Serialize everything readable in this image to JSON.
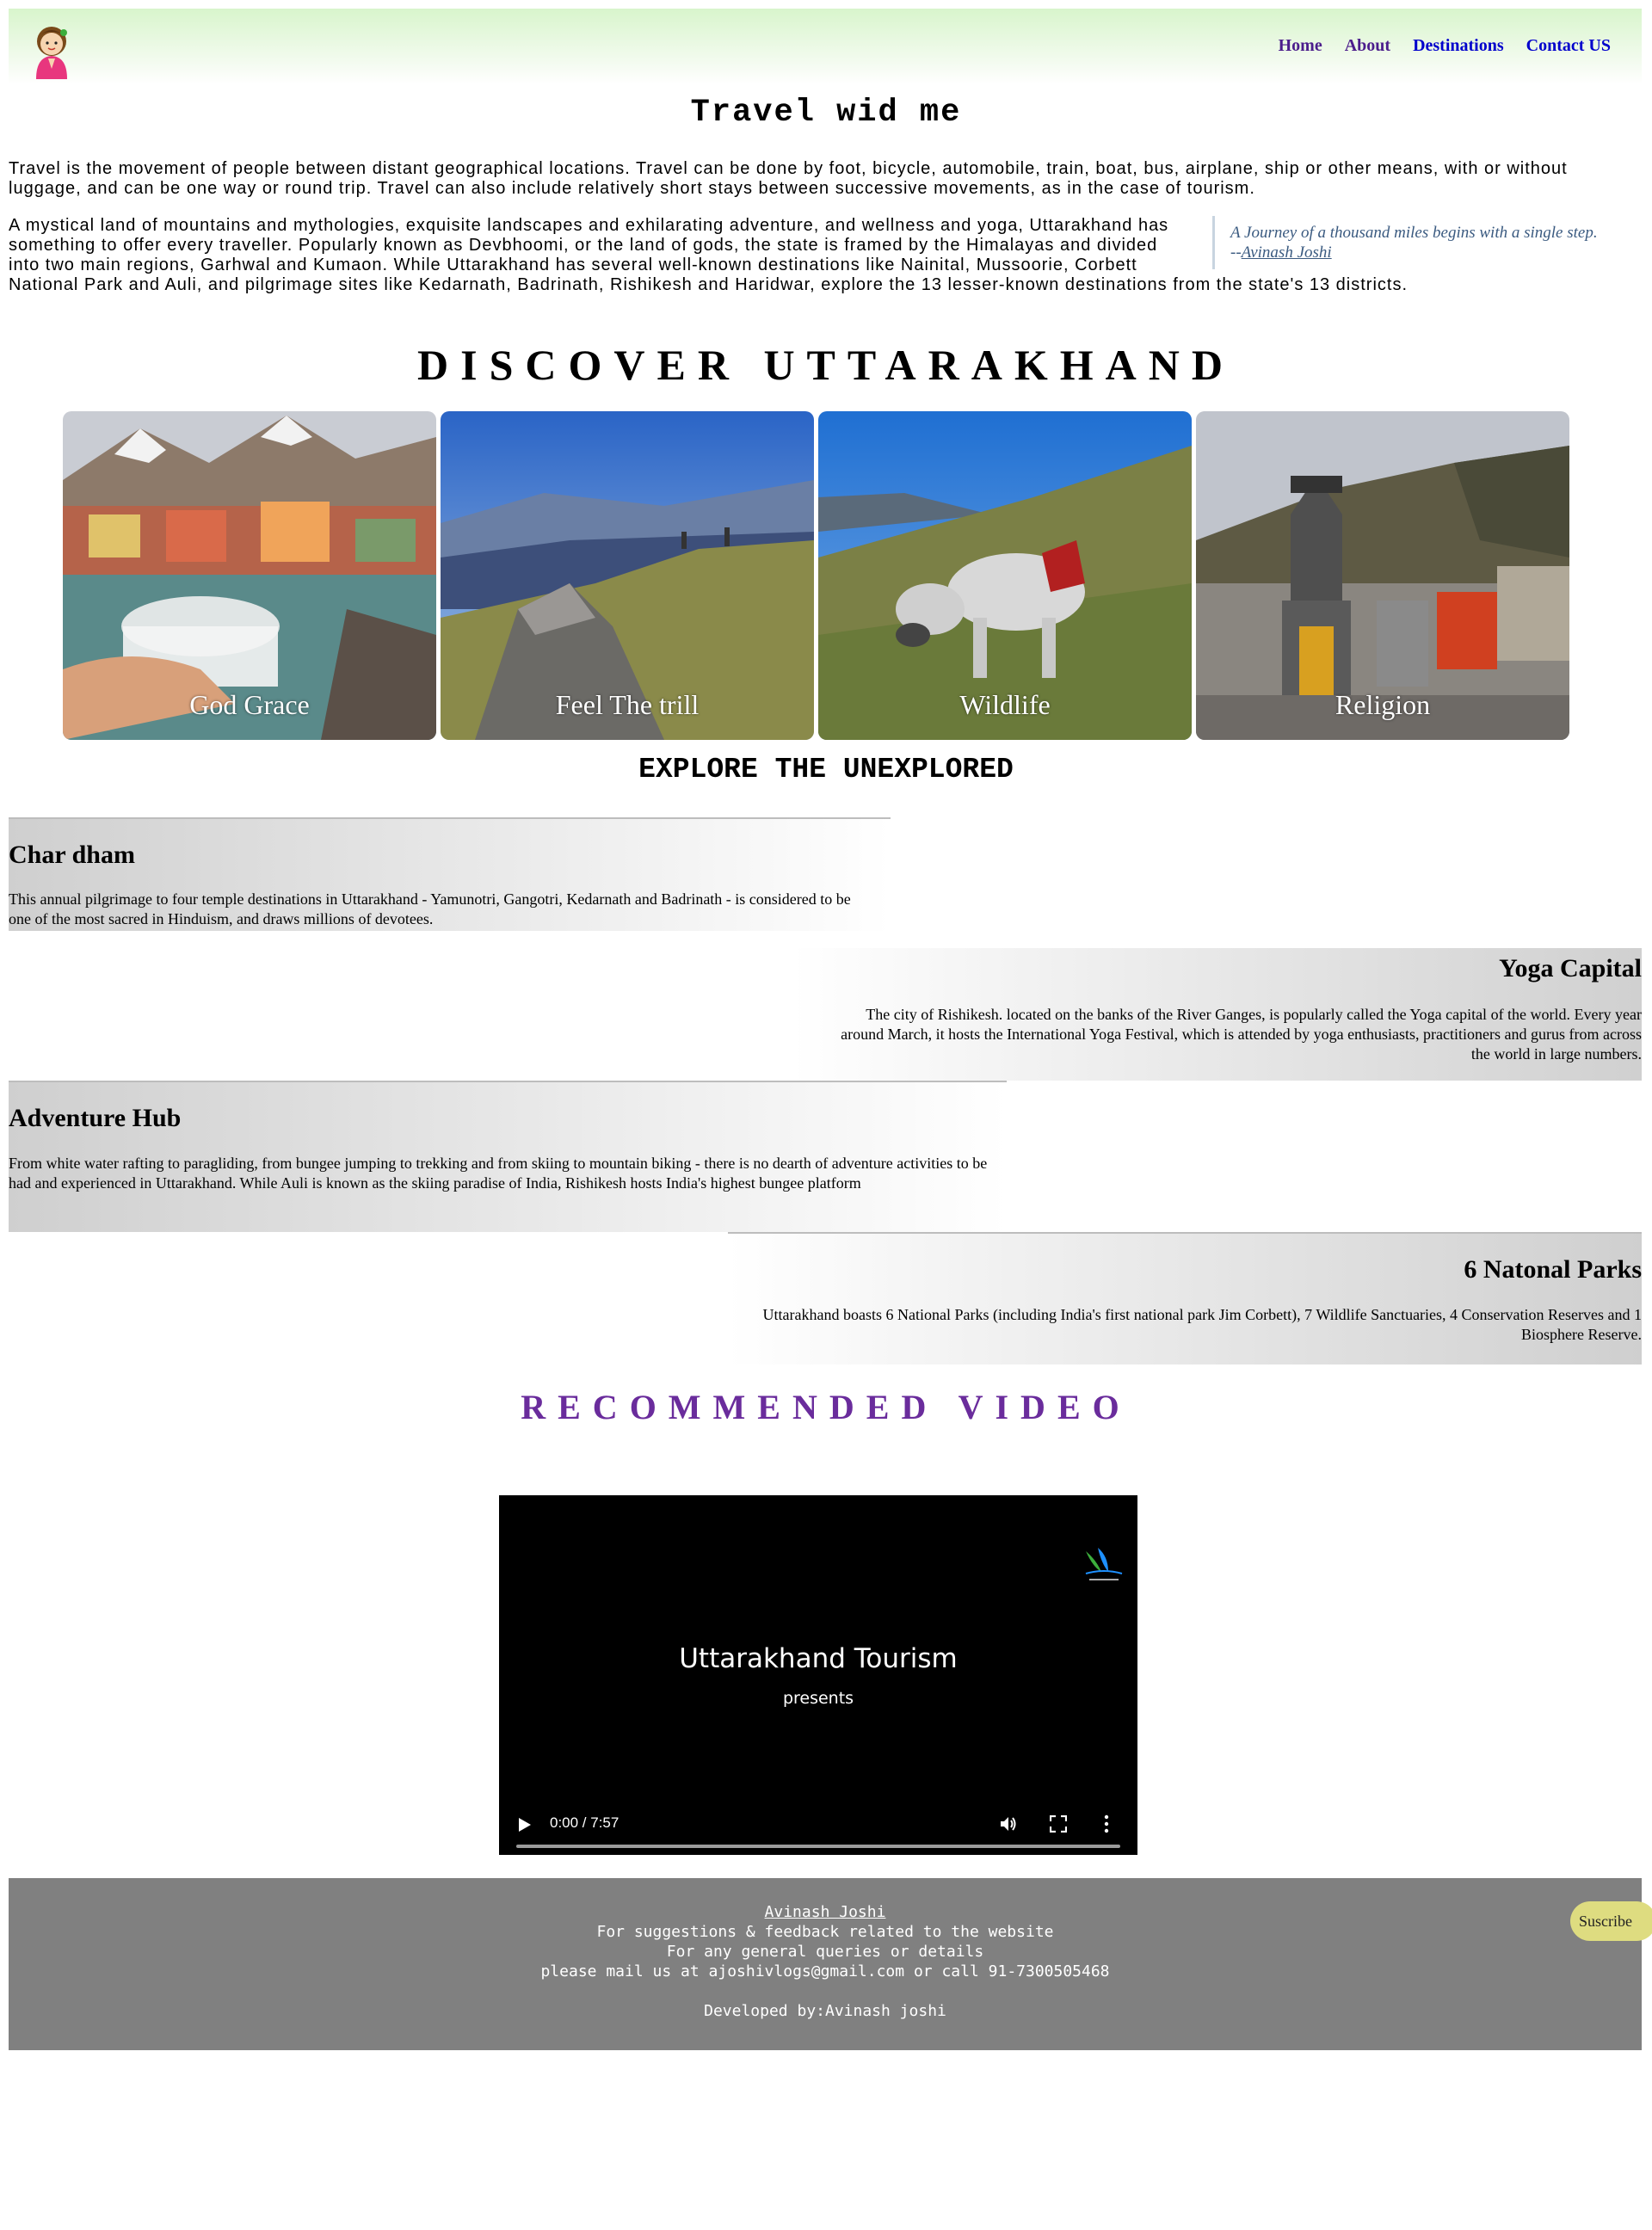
{
  "header": {
    "logo_icon": "girl-namaste-icon",
    "nav": [
      {
        "label": "Home",
        "state": "visited"
      },
      {
        "label": "About",
        "state": "visited"
      },
      {
        "label": "Destinations",
        "state": "link"
      },
      {
        "label": "Contact US",
        "state": "link"
      }
    ]
  },
  "intro": {
    "title": "Travel wid me",
    "paragraph1": "Travel is the movement of people between distant geographical locations. Travel can be done by foot, bicycle, automobile, train, boat, bus, airplane, ship or other means, with or without luggage, and can be one way or round trip. Travel can also include relatively short stays between successive movements, as in the case of tourism.",
    "paragraph2": "A mystical land of mountains and mythologies, exquisite landscapes and exhilarating adventure, and wellness and yoga, Uttarakhand has something to offer every traveller. Popularly known as Devbhoomi, or the land of gods, the state is framed by the Himalayas and divided into two main regions, Garhwal and Kumaon. While Uttarakhand has several well-known destinations like Nainital, Mussoorie, Corbett National Park and Auli, and pilgrimage sites like Kedarnath, Badrinath, Rishikesh and Haridwar, explore the 13 lesser-known destinations from the state's 13 districts.",
    "quote": "A Journey of a thousand miles begins with a single step.",
    "quote_prefix": "--",
    "quote_author": "Avinash Joshi"
  },
  "discover": {
    "heading": "DISCOVER UTTARAKHAND",
    "cards": [
      {
        "caption": "God Grace"
      },
      {
        "caption": "Feel The trill"
      },
      {
        "caption": "Wildlife"
      },
      {
        "caption": "Religion"
      }
    ]
  },
  "explore": {
    "heading": "EXPLORE THE UNEXPLORED",
    "sections": [
      {
        "title": "Char dham",
        "text": "This annual pilgrimage to four temple destinations in Uttarakhand - Yamunotri, Gangotri, Kedarnath and Badrinath - is considered to be one of the most sacred in Hinduism, and draws millions of devotees."
      },
      {
        "title": "Yoga Capital",
        "text": "The city of Rishikesh. located on the banks of the River Ganges, is popularly called the Yoga capital of the world. Every year around March, it hosts the International Yoga Festival, which is attended by yoga enthusiasts, practitioners and gurus from across the world in large numbers."
      },
      {
        "title": "Adventure Hub",
        "text": "From white water rafting to paragliding, from bungee jumping to trekking and from skiing to mountain biking - there is no dearth of adventure activities to be had and experienced in Uttarakhand. While Auli is known as the skiing paradise of India, Rishikesh hosts India's highest bungee platform"
      },
      {
        "title": "6 Natonal Parks",
        "text": "Uttarakhand boasts 6 National Parks (including India's first national park Jim Corbett), 7 Wildlife Sanctuaries, 4 Conservation Reserves and 1 Biosphere Reserve."
      }
    ]
  },
  "video": {
    "heading": "RECOMMENDED VIDEO",
    "title": "Uttarakhand Tourism",
    "subtitle": "presents",
    "time": "0:00 / 7:57",
    "progress": 0
  },
  "footer": {
    "name": "Avinash Joshi",
    "line1": "For suggestions & feedback related to the website",
    "line2": "For any general queries or details",
    "line3": "please mail us at ajoshivlogs@gmail.com or call 91-7300505468",
    "credit": "Developed by:Avinash joshi",
    "subscribe": "Suscribe"
  },
  "colors": {
    "nav_visited": "#4b1d8c",
    "nav_link": "#0000cc",
    "header_gradient": "#d8f5cc",
    "recommended_heading": "#6a2c9c",
    "footer_bg": "#808080",
    "subscribe_bg": "#dedc80"
  }
}
